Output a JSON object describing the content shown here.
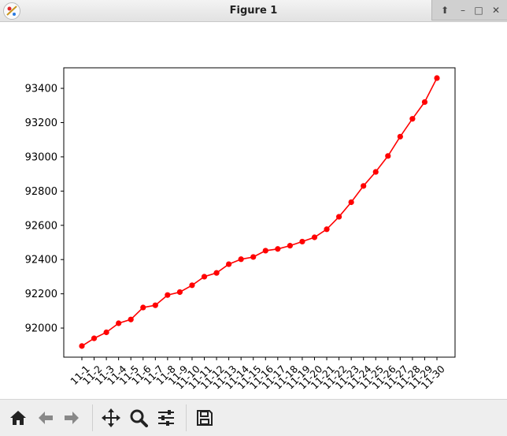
{
  "window": {
    "title": "Figure 1"
  },
  "toolbar": {
    "buttons": [
      {
        "name": "home-icon"
      },
      {
        "name": "back-icon"
      },
      {
        "name": "forward-icon"
      },
      {
        "name": "pan-icon"
      },
      {
        "name": "zoom-icon"
      },
      {
        "name": "configure-subplots-icon"
      },
      {
        "name": "save-icon"
      }
    ]
  },
  "chart_data": {
    "type": "line",
    "categories": [
      "11-1",
      "11-2",
      "11-3",
      "11-4",
      "11-5",
      "11-6",
      "11-7",
      "11-8",
      "11-9",
      "11-10",
      "11-11",
      "11-12",
      "11-13",
      "11-14",
      "11-15",
      "11-16",
      "11-17",
      "11-18",
      "11-19",
      "11-20",
      "11-21",
      "11-22",
      "11-23",
      "11-24",
      "11-25",
      "11-26",
      "11-27",
      "11-28",
      "11-29",
      "11-30"
    ],
    "values": [
      91895,
      91940,
      91975,
      92028,
      92050,
      92120,
      92133,
      92193,
      92210,
      92250,
      92300,
      92322,
      92373,
      92402,
      92415,
      92452,
      92462,
      92481,
      92505,
      92530,
      92577,
      92650,
      92735,
      92830,
      92912,
      93005,
      93118,
      93222,
      93320,
      93460
    ],
    "ylim": [
      91830,
      93520
    ],
    "yticks": [
      "92000",
      "92200",
      "92400",
      "92600",
      "92800",
      "93000",
      "93200",
      "93400"
    ],
    "color": "#ff0000",
    "grid": false
  }
}
